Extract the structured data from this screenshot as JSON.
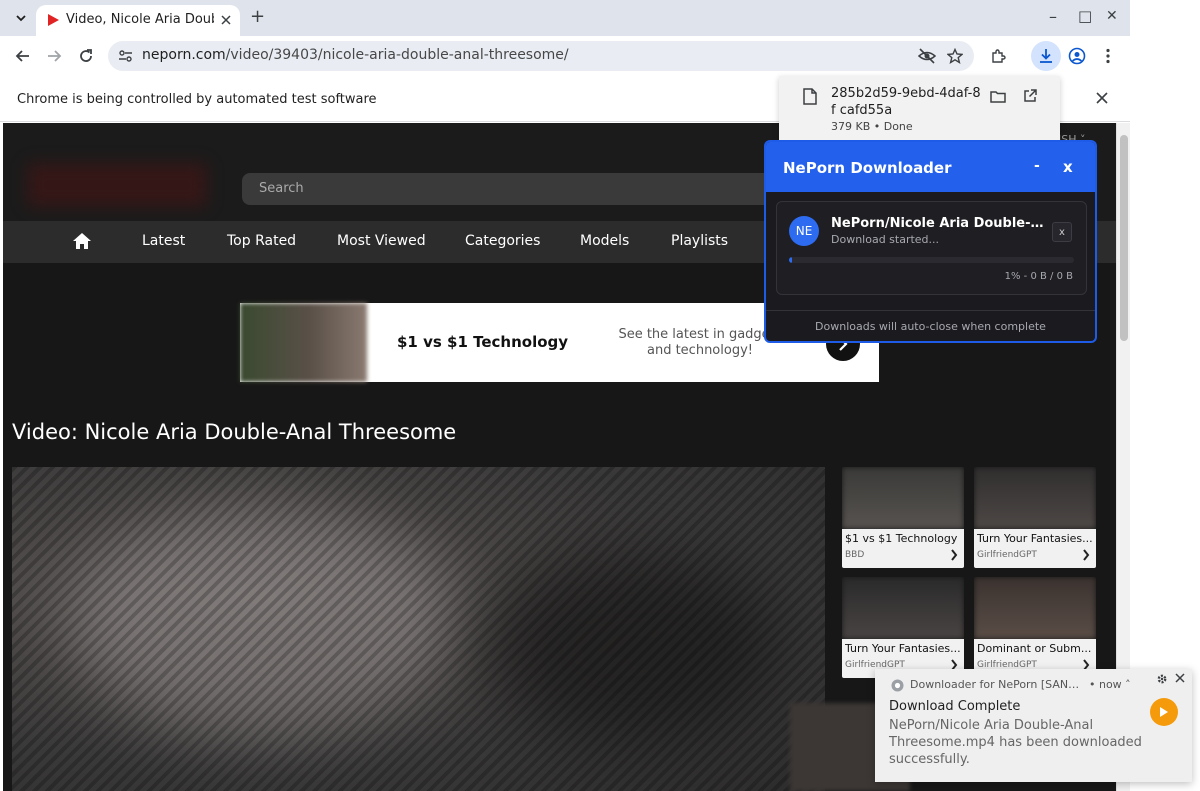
{
  "browser": {
    "tab_title": "Video, Nicole Aria Double-Anal Threesome",
    "url_host": "neporn.com",
    "url_path": "/video/39403/nicole-aria-double-anal-threesome/",
    "infobar_text": "Chrome is being controlled by automated test software",
    "new_tab": "+",
    "min": "–",
    "max": "□",
    "close": "✕"
  },
  "download_bubble": {
    "filename": "285b2d59-9ebd-4daf-8f cafd55a",
    "status": "379 KB • Done"
  },
  "site": {
    "search_placeholder": "Search",
    "lang_label": "ISH ˅",
    "nav": [
      "Latest",
      "Top Rated",
      "Most Viewed",
      "Categories",
      "Models",
      "Playlists"
    ],
    "ad": {
      "title": "$1 vs $1 Technology",
      "desc": "See the latest in gadgets and technology!"
    },
    "video_heading": "Video: Nicole Aria Double-Anal Threesome",
    "related": [
      {
        "title": "$1 vs $1 Technology",
        "sub": "BBD"
      },
      {
        "title": "Turn Your Fantasies...",
        "sub": "GirlfriendGPT"
      },
      {
        "title": "Turn Your Fantasies...",
        "sub": "GirlfriendGPT"
      },
      {
        "title": "Dominant or Subm...",
        "sub": "GirlfriendGPT"
      }
    ]
  },
  "extension": {
    "title": "NePorn Downloader",
    "minimize": "-",
    "close": "x",
    "item": {
      "avatar": "NE",
      "title": "NePorn/Nicole Aria Double-Anal Threesome",
      "status": "Download started...",
      "progress_text": "1% - 0 B / 0 B",
      "progress": 0.01,
      "cancel": "x"
    },
    "footer": "Downloads will auto-close when complete"
  },
  "notification": {
    "source": "Downloader for NePorn [SANDBOXED]",
    "time": "•  now ˄",
    "title": "Download Complete",
    "body": "NePorn/Nicole Aria Double-Anal Threesome.mp4 has been downloaded successfully."
  },
  "colors": {
    "accent_blue": "#2360ec",
    "notif_orange": "#f59b0b",
    "site_bg": "#171717"
  }
}
